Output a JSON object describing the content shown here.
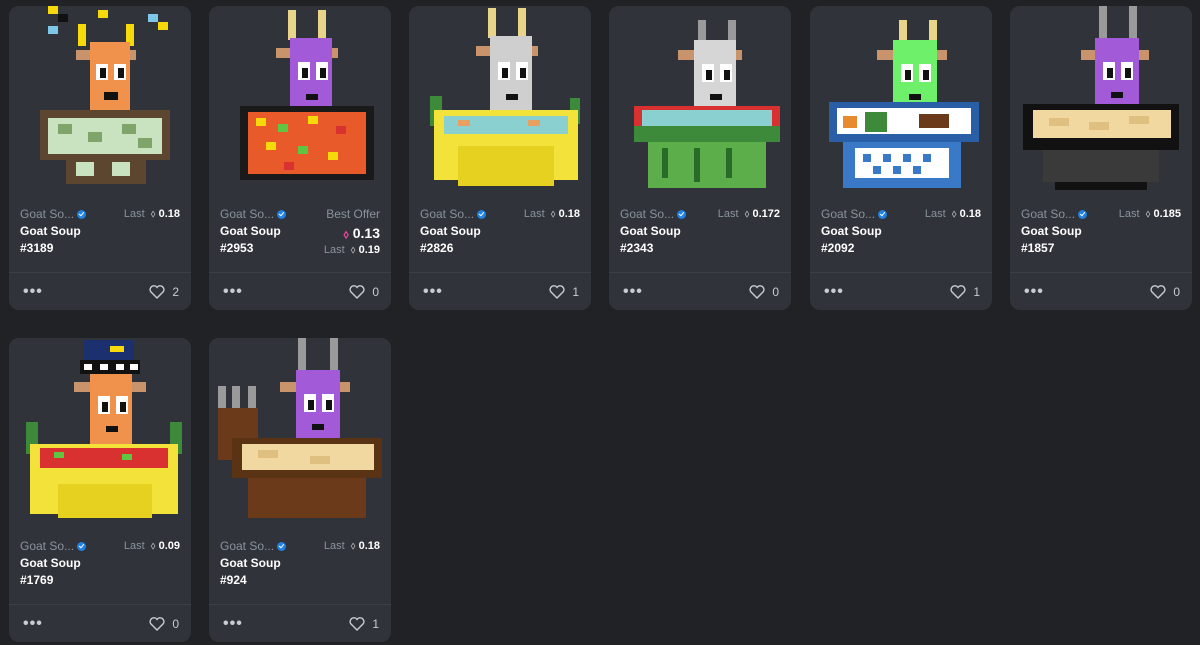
{
  "collection_name": "Goat So...",
  "item_name": "Goat Soup",
  "last_label": "Last",
  "best_offer_label": "Best Offer",
  "more_label": "•••",
  "eth_symbol": "⬨",
  "cards": [
    {
      "token": "#3189",
      "last": "0.18",
      "likes": "2",
      "goat": "orange",
      "bowl": "camo"
    },
    {
      "token": "#2953",
      "best_offer": "0.13",
      "last": "0.19",
      "likes": "0",
      "goat": "purple",
      "bowl": "sprinkle"
    },
    {
      "token": "#2826",
      "last": "0.18",
      "likes": "1",
      "goat": "white",
      "bowl": "yellow"
    },
    {
      "token": "#2343",
      "last": "0.172",
      "likes": "0",
      "goat": "white",
      "bowl": "watermelon"
    },
    {
      "token": "#2092",
      "last": "0.18",
      "likes": "1",
      "goat": "green",
      "bowl": "blue"
    },
    {
      "token": "#1857",
      "last": "0.185",
      "likes": "0",
      "goat": "purple",
      "bowl": "black"
    },
    {
      "token": "#1769",
      "last": "0.09",
      "likes": "0",
      "goat": "orange",
      "bowl": "yellow"
    },
    {
      "token": "#924",
      "last": "0.18",
      "likes": "1",
      "goat": "purple",
      "bowl": "brown"
    }
  ]
}
